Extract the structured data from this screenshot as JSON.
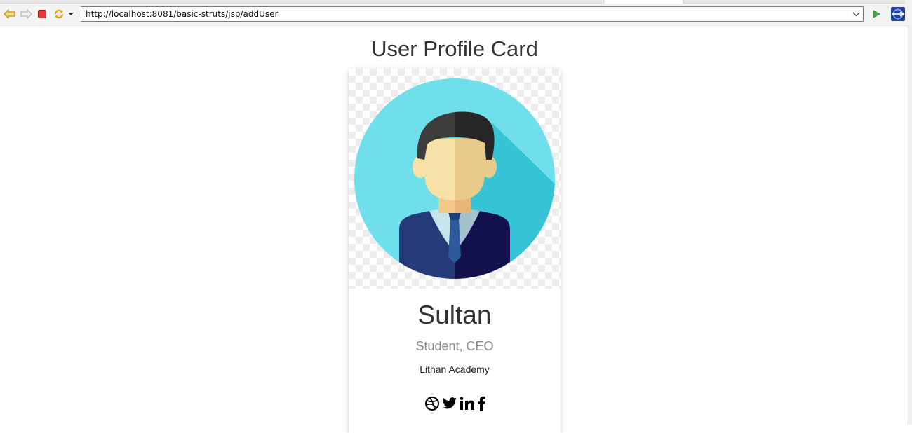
{
  "browser": {
    "url": "http://localhost:8081/basic-struts/jsp/addUser",
    "icons": [
      "back-icon",
      "forward-icon",
      "stop-icon",
      "refresh-icon",
      "menu-dropdown-icon",
      "url-dropdown-icon",
      "go-icon",
      "browser-logo-icon"
    ]
  },
  "page": {
    "title": "User Profile Card"
  },
  "profile": {
    "name": "Sultan",
    "role": "Student, CEO",
    "organization": "Lithan Academy",
    "social_icons": [
      "dribbble-icon",
      "twitter-icon",
      "linkedin-icon",
      "facebook-icon"
    ]
  },
  "colors": {
    "avatar_circle": "#6fdfec",
    "avatar_shadow": "#37c3d6",
    "suit": "#253a78",
    "suit_dark": "#12104d",
    "hair": "#2b2b2b",
    "skin": "#f7e1a6"
  }
}
